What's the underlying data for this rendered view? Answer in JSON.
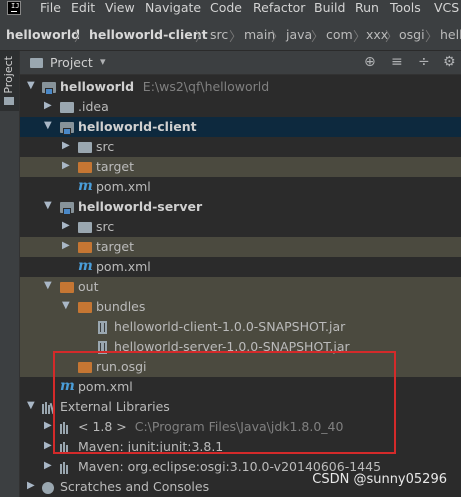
{
  "menubar": {
    "logo": "IJ",
    "items": [
      "File",
      "Edit",
      "View",
      "Navigate",
      "Code",
      "Refactor",
      "Build",
      "Run",
      "Tools",
      "VCS"
    ]
  },
  "breadcrumb": {
    "items": [
      "helloworld",
      "helloworld-client",
      "src",
      "main",
      "java",
      "com",
      "xxx",
      "osgi",
      "hell"
    ],
    "separator": "〉"
  },
  "side_tab": {
    "label": "Project"
  },
  "tool_window": {
    "title": "Project",
    "view_dropdown": "▾",
    "buttons": [
      "⊕",
      "≡",
      "÷",
      "⚙"
    ]
  },
  "tree": [
    {
      "name": "helloworld",
      "hint": "E:\\ws2\\qf\\helloworld",
      "expanded": true
    },
    {
      "name": ".idea"
    },
    {
      "name": "helloworld-client",
      "expanded": true
    },
    {
      "name": "src"
    },
    {
      "name": "target"
    },
    {
      "name": "pom.xml"
    },
    {
      "name": "helloworld-server",
      "expanded": true
    },
    {
      "name": "src"
    },
    {
      "name": "target"
    },
    {
      "name": "pom.xml"
    },
    {
      "name": "out",
      "expanded": true
    },
    {
      "name": "bundles",
      "expanded": true
    },
    {
      "name": "helloworld-client-1.0.0-SNAPSHOT.jar"
    },
    {
      "name": "helloworld-server-1.0.0-SNAPSHOT.jar"
    },
    {
      "name": "run.osgi"
    },
    {
      "name": "pom.xml"
    },
    {
      "name": "External Libraries",
      "expanded": true
    },
    {
      "name": "< 1.8 >",
      "hint": "C:\\Program Files\\Java\\jdk1.8.0_40"
    },
    {
      "name": "Maven: junit:junit:3.8.1"
    },
    {
      "name": "Maven: org.eclipse:osgi:3.10.0-v20140606-1445"
    },
    {
      "name": "Scratches and Consoles"
    }
  ],
  "watermark": "CSDN @sunny05296"
}
